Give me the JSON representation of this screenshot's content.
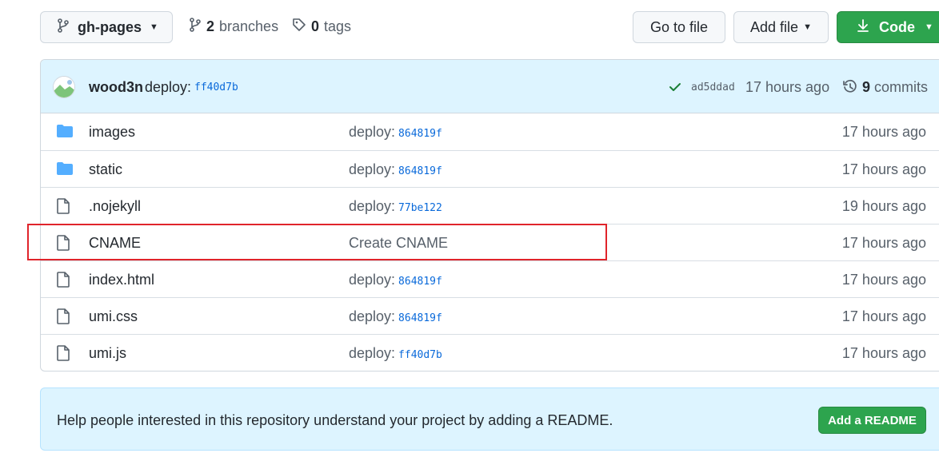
{
  "toolbar": {
    "branch_label": "gh-pages",
    "branches_count": "2",
    "branches_label": "branches",
    "tags_count": "0",
    "tags_label": "tags",
    "goto_label": "Go to file",
    "addfile_label": "Add file",
    "code_label": "Code"
  },
  "commit": {
    "author": "wood3n",
    "message": "deploy:",
    "hash": "ff40d7b",
    "latest_hash": "ad5ddad",
    "time": "17 hours ago",
    "commits_count": "9",
    "commits_label": "commits"
  },
  "files": [
    {
      "type": "folder",
      "name": "images",
      "msg": "deploy:",
      "hash": "864819f",
      "age": "17 hours ago"
    },
    {
      "type": "folder",
      "name": "static",
      "msg": "deploy:",
      "hash": "864819f",
      "age": "17 hours ago"
    },
    {
      "type": "file",
      "name": ".nojekyll",
      "msg": "deploy:",
      "hash": "77be122",
      "age": "19 hours ago"
    },
    {
      "type": "file",
      "name": "CNAME",
      "msg": "Create CNAME",
      "hash": "",
      "age": "17 hours ago"
    },
    {
      "type": "file",
      "name": "index.html",
      "msg": "deploy:",
      "hash": "864819f",
      "age": "17 hours ago"
    },
    {
      "type": "file",
      "name": "umi.css",
      "msg": "deploy:",
      "hash": "864819f",
      "age": "17 hours ago"
    },
    {
      "type": "file",
      "name": "umi.js",
      "msg": "deploy:",
      "hash": "ff40d7b",
      "age": "17 hours ago"
    }
  ],
  "readme": {
    "text": "Help people interested in this repository understand your project by adding a README.",
    "button_label": "Add a README"
  },
  "colors": {
    "accent_green": "#2da44e",
    "link_blue": "#0969da",
    "folder_blue": "#54aeff",
    "highlight_red": "#e0242b"
  }
}
